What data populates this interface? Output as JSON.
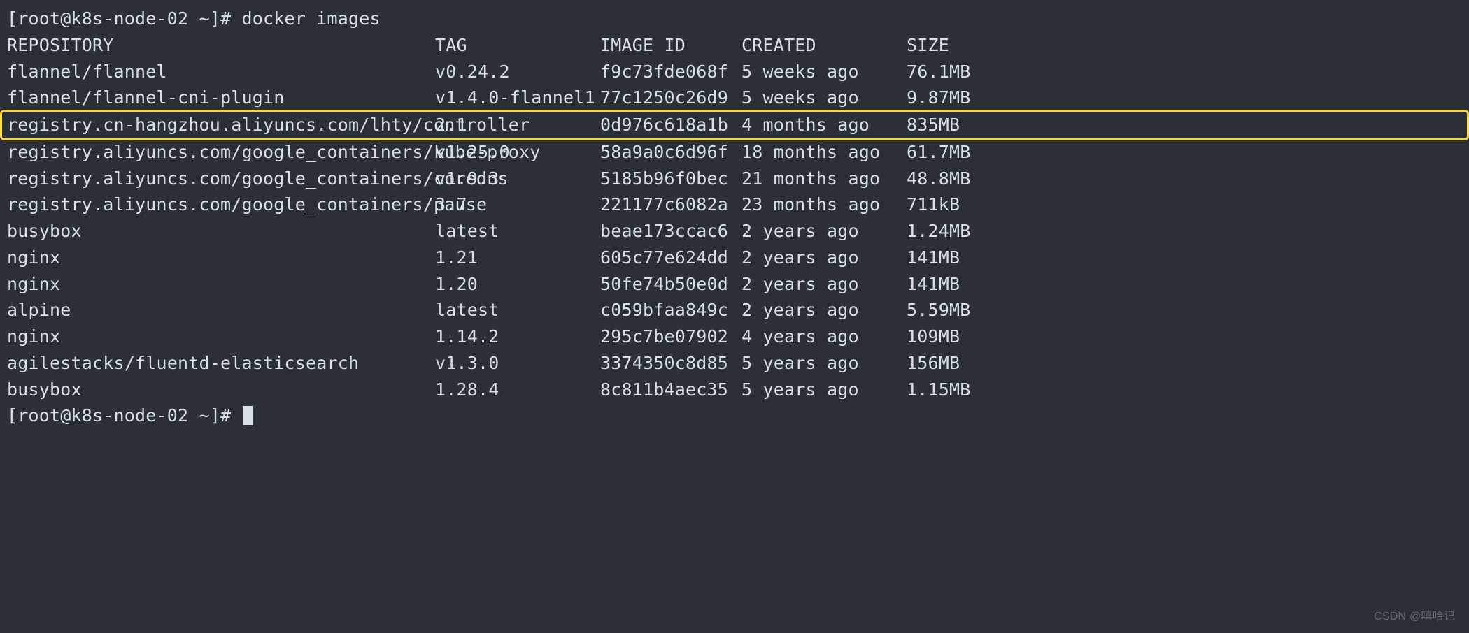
{
  "prompt1": "[root@k8s-node-02 ~]# ",
  "command": "docker images",
  "prompt2": "[root@k8s-node-02 ~]# ",
  "header": {
    "repo": "REPOSITORY",
    "tag": "TAG",
    "image": "IMAGE ID",
    "created": "CREATED",
    "size": "SIZE"
  },
  "rows": [
    {
      "repo": "flannel/flannel",
      "tag": "v0.24.2",
      "image": "f9c73fde068f",
      "created": "5 weeks ago",
      "size": "76.1MB",
      "hl": false
    },
    {
      "repo": "flannel/flannel-cni-plugin",
      "tag": "v1.4.0-flannel1",
      "image": "77c1250c26d9",
      "created": "5 weeks ago",
      "size": "9.87MB",
      "hl": false
    },
    {
      "repo": "registry.cn-hangzhou.aliyuncs.com/lhty/controller",
      "tag": "2.1",
      "image": "0d976c618a1b",
      "created": "4 months ago",
      "size": "835MB",
      "hl": true
    },
    {
      "repo": "registry.aliyuncs.com/google_containers/kube-proxy",
      "tag": "v1.25.0",
      "image": "58a9a0c6d96f",
      "created": "18 months ago",
      "size": "61.7MB",
      "hl": false
    },
    {
      "repo": "registry.aliyuncs.com/google_containers/coredns",
      "tag": "v1.9.3",
      "image": "5185b96f0bec",
      "created": "21 months ago",
      "size": "48.8MB",
      "hl": false
    },
    {
      "repo": "registry.aliyuncs.com/google_containers/pause",
      "tag": "3.7",
      "image": "221177c6082a",
      "created": "23 months ago",
      "size": "711kB",
      "hl": false
    },
    {
      "repo": "busybox",
      "tag": "latest",
      "image": "beae173ccac6",
      "created": "2 years ago",
      "size": "1.24MB",
      "hl": false
    },
    {
      "repo": "nginx",
      "tag": "1.21",
      "image": "605c77e624dd",
      "created": "2 years ago",
      "size": "141MB",
      "hl": false
    },
    {
      "repo": "nginx",
      "tag": "1.20",
      "image": "50fe74b50e0d",
      "created": "2 years ago",
      "size": "141MB",
      "hl": false
    },
    {
      "repo": "alpine",
      "tag": "latest",
      "image": "c059bfaa849c",
      "created": "2 years ago",
      "size": "5.59MB",
      "hl": false
    },
    {
      "repo": "nginx",
      "tag": "1.14.2",
      "image": "295c7be07902",
      "created": "4 years ago",
      "size": "109MB",
      "hl": false
    },
    {
      "repo": "agilestacks/fluentd-elasticsearch",
      "tag": "v1.3.0",
      "image": "3374350c8d85",
      "created": "5 years ago",
      "size": "156MB",
      "hl": false
    },
    {
      "repo": "busybox",
      "tag": "1.28.4",
      "image": "8c811b4aec35",
      "created": "5 years ago",
      "size": "1.15MB",
      "hl": false
    }
  ],
  "watermark": "CSDN @嘻哈记"
}
